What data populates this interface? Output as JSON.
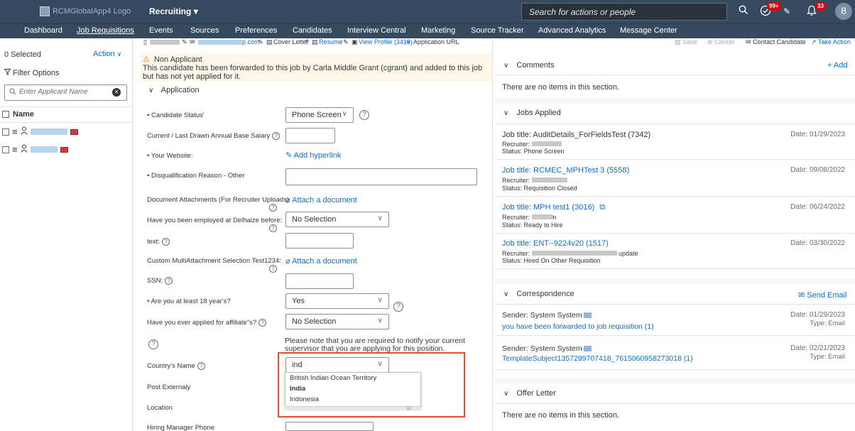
{
  "shell": {
    "logo_alt": "RCMGlobalApp4 Logo",
    "app_title": "Recruiting",
    "app_caret": "▾",
    "search_placeholder": "Search for actions or people",
    "notification_count_1": "99+",
    "notification_count_2": "33",
    "avatar_initial": "8"
  },
  "nav": {
    "items": [
      "Dashboard",
      "Job Requisitions",
      "Events",
      "Sources",
      "Preferences",
      "Candidates",
      "Interview Central",
      "Marketing",
      "Source Tracker",
      "Advanced Analytics",
      "Message Center"
    ],
    "active": "Job Requisitions"
  },
  "left_panel": {
    "selected_count": "0 Selected",
    "action_label": "Action",
    "filter_label": "Filter Options",
    "search_placeholder": "Enter Applicant Name",
    "column_header": "Name"
  },
  "toolbar": {
    "email_suffix": "p.com",
    "cover_letter": "Cover Letter",
    "resume": "Resume",
    "view_profile": "View Profile (3419)",
    "application_url": "Application URL",
    "save": "Save",
    "cancel": "Cancel",
    "contact_candidate": "Contact Candidate",
    "take_action": "Take Action"
  },
  "warning": {
    "title": "Non Applicant",
    "message": "This candidate has been forwarded to this job by Carla Middle Grant (cgrant) and added to this job but has not yet applied for it."
  },
  "application": {
    "section_title": "Application",
    "fields": {
      "candidate_status_label": "Candidate Status'",
      "candidate_status_value": "Phone Screen",
      "salary_label": "Current / Last Drawn Annual Base Salary",
      "website_label": "Your Website:",
      "website_link": "Add hyperlink",
      "disqualification_label": "Disqualification Reason - Other",
      "doc_attachments_label": "Document Attachments (For Recruiter Uploads)",
      "attach_document_1": "Attach a document",
      "delhaize_label": "Have you been employed at Delhaize before:",
      "delhaize_value": "No Selection",
      "text_label": "text:",
      "custom_multi_label": "Custom MultiAttachment Selection Test1234:",
      "attach_document_2": "Attach a document",
      "ssn_label": "SSN:",
      "age_label": "Are you at least 18 year's?",
      "age_value": "Yes",
      "affiliates_label": "Have you ever applied for affiliate\"s?",
      "affiliates_value": "No Selection",
      "supervisor_note": "Please note that you are required to notify your current supervisor that you are applying for this position.",
      "country_label": "Country's Name",
      "country_value": "ind",
      "post_externally_label": "Post Externaly",
      "location_label": "Location",
      "hiring_manager_phone_label": "Hiring Manager Phone"
    },
    "country_options": [
      "British Indian Ocean Territory",
      "India",
      "Indonesia"
    ]
  },
  "right": {
    "comments": {
      "title": "Comments",
      "add": "+ Add",
      "empty": "There are no items in this section."
    },
    "jobs_applied": {
      "title": "Jobs Applied",
      "items": [
        {
          "title": "Job title: AuditDetails_ForFieldsTest (7342)",
          "date": "Date: 01/29/2023",
          "recruiter": "Recruiter:",
          "status": "Status: Phone Screen"
        },
        {
          "title": "Job title: RCMEC_MPHTest 3 (5558)",
          "date": "Date: 09/08/2022",
          "recruiter": "Recruiter:",
          "status": "Status: Requisition Closed"
        },
        {
          "title": "Job title: MPH test1 (3016)",
          "date": "Date: 06/24/2022",
          "recruiter": "Recruiter:",
          "recruiter_suffix": "n",
          "status": "Status: Ready to Hire"
        },
        {
          "title": "Job title: ENT--9224v20 (1517)",
          "date": "Date: 03/30/2022",
          "recruiter": "Recruiter:",
          "recruiter_suffix": "update",
          "status": "Status: Hired On Other Requisition"
        }
      ]
    },
    "correspondence": {
      "title": "Correspondence",
      "send_email": "Send Email",
      "items": [
        {
          "sender": "Sender: System System",
          "subject": "you have been forwarded to job requisition (1)",
          "date": "Date: 01/29/2023",
          "type": "Type: Email"
        },
        {
          "sender": "Sender: System System",
          "subject": "TemplateSubject1357299707418_7615060958273018 (1)",
          "date": "Date: 02/21/2023",
          "type": "Type: Email"
        }
      ]
    },
    "offer_letter": {
      "title": "Offer Letter",
      "empty": "There are no items in this section."
    }
  },
  "colors": {
    "shell": "#354a5f",
    "link": "#0a6ed1",
    "warning_bg": "#fef7ea",
    "highlight": "#e8502a"
  }
}
